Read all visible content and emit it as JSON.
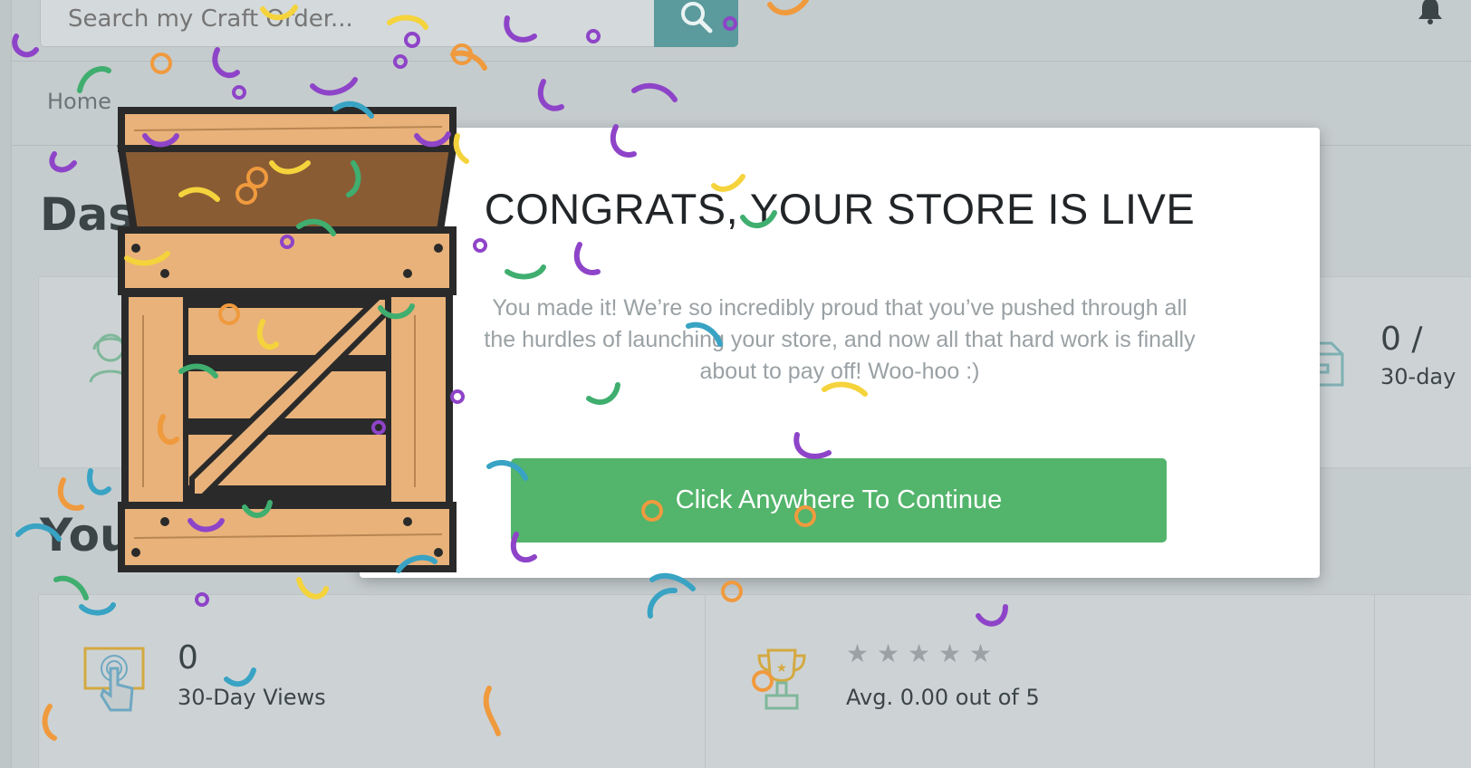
{
  "header": {
    "search_placeholder": "Search my Craft Order...",
    "search_button_icon": "search-icon",
    "notification_icon": "bell-icon"
  },
  "breadcrumb": {
    "home": "Home"
  },
  "dashboard": {
    "title": "Dashboard",
    "section_title": "Your Stats",
    "top_card": {
      "value": "0 /",
      "label": "30-day"
    },
    "views": {
      "value": "0",
      "label": "30-Day Views",
      "icon": "touch-screen-icon"
    },
    "rating": {
      "label": "Avg. 0.00 out of 5",
      "stars_filled": 0,
      "stars_total": 5,
      "icon": "trophy-icon"
    }
  },
  "modal": {
    "title": "CONGRATS, YOUR STORE IS LIVE",
    "body": "You made it! We’re so incredibly proud that you’ve pushed through all the hurdles of launching your store, and now all that hard work is finally about to pay off! Woo-hoo :)",
    "button": "Click Anywhere To Continue",
    "illustration": "open-crate-icon"
  },
  "colors": {
    "accent_green": "#53b46b",
    "search_teal": "#5b9a9d",
    "confetti": [
      "#8e44c8",
      "#f5d33c",
      "#3fae6f",
      "#39a3c4",
      "#f09a3e"
    ]
  }
}
